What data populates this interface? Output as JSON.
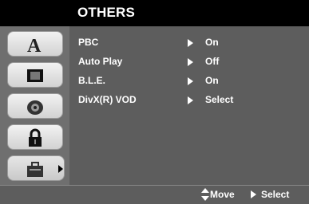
{
  "title": "OTHERS",
  "sidebar": {
    "tabs": [
      {
        "icon": "language-icon"
      },
      {
        "icon": "display-icon"
      },
      {
        "icon": "audio-icon"
      },
      {
        "icon": "lock-icon"
      },
      {
        "icon": "others-icon",
        "selected": true
      }
    ]
  },
  "menu": {
    "items": [
      {
        "label": "PBC",
        "value": "On"
      },
      {
        "label": "Auto Play",
        "value": "Off"
      },
      {
        "label": "B.L.E.",
        "value": "On"
      },
      {
        "label": "DivX(R) VOD",
        "value": "Select"
      }
    ]
  },
  "footer": {
    "move_label": "Move",
    "select_label": "Select"
  },
  "colors": {
    "panel_bg": "#5d5d5d",
    "sidebar_bg": "#6f6f6f",
    "title_bg": "#000000",
    "text": "#ffffff"
  }
}
